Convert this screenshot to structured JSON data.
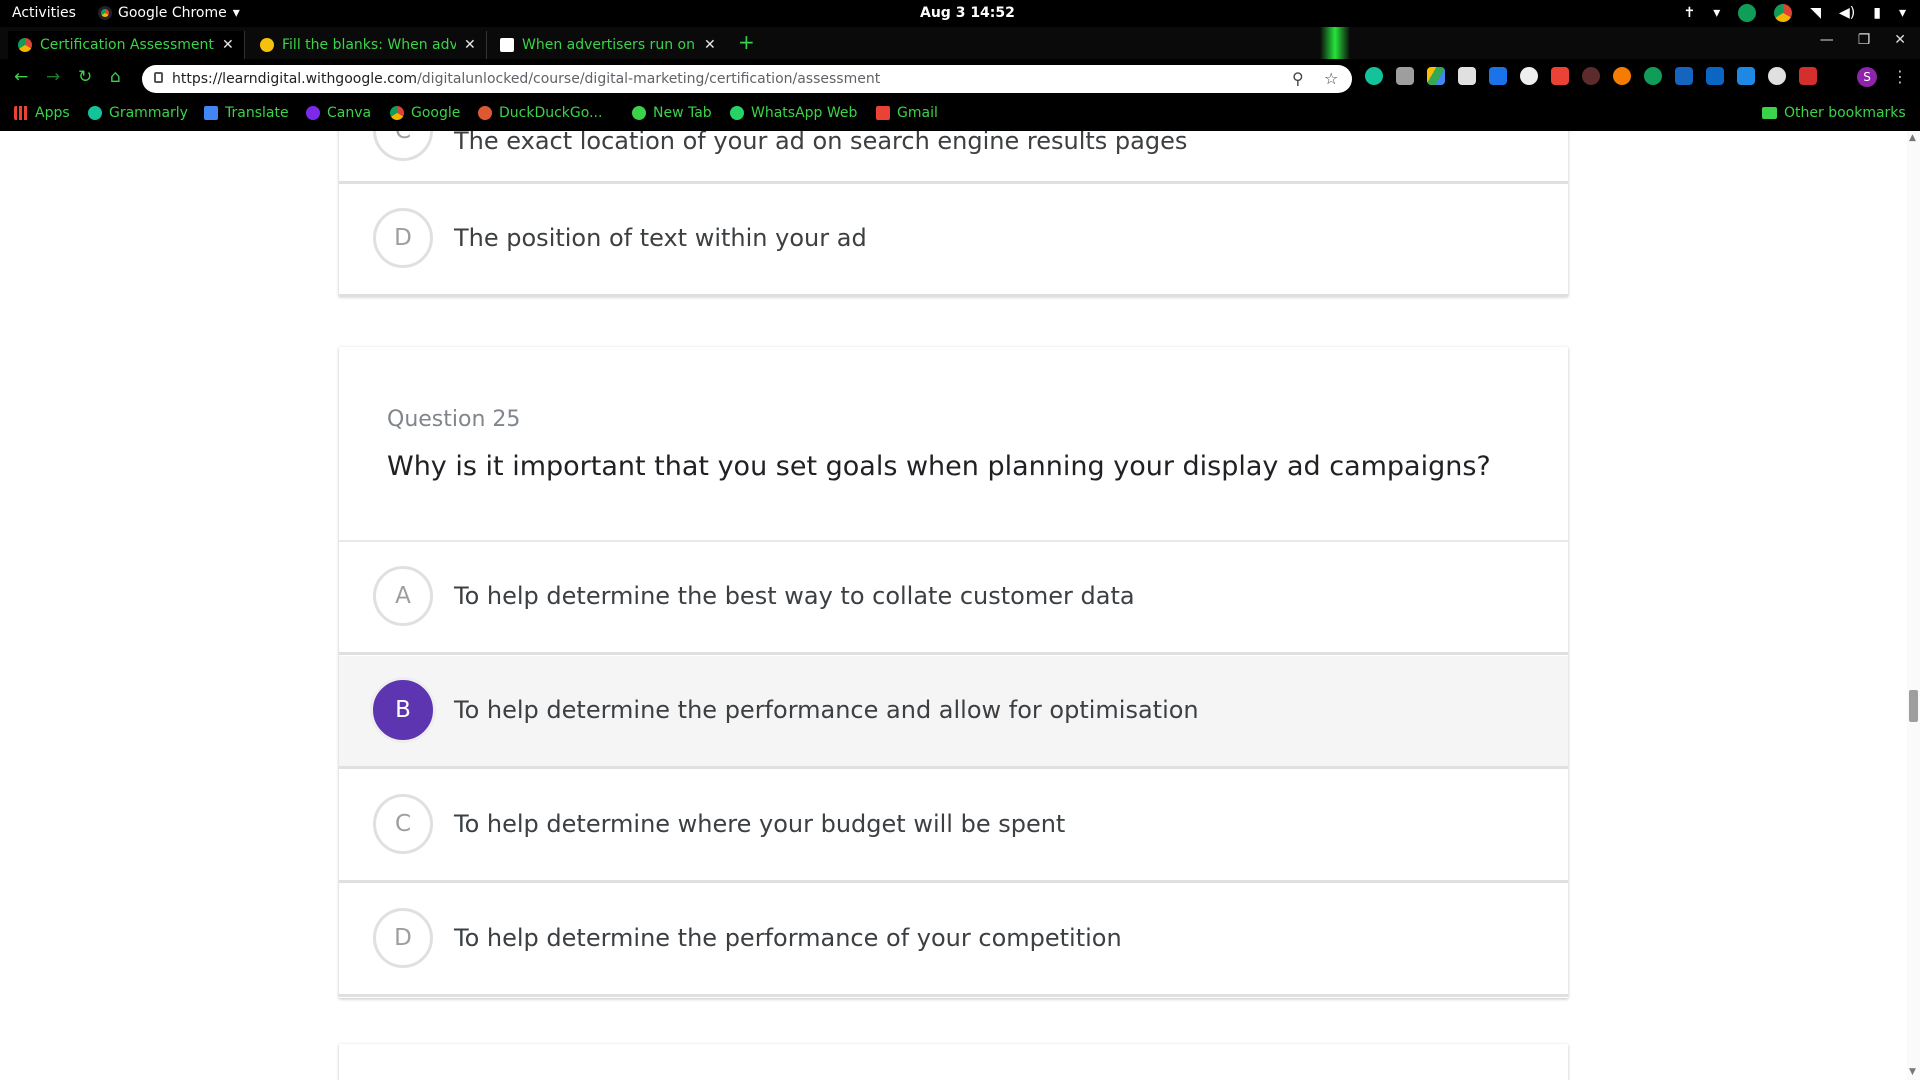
{
  "system_bar": {
    "activities": "Activities",
    "app_name": "Google Chrome",
    "clock": "Aug 3  14:52"
  },
  "tabs": [
    {
      "title": "Certification Assessment",
      "active": true
    },
    {
      "title": "Fill the blanks: When adv"
    },
    {
      "title": "When advertisers run onl"
    }
  ],
  "omnibox": {
    "host": "https://learndigital.withgoogle.com",
    "path": "/digitalunlocked/course/digital-marketing/certification/assessment"
  },
  "profile_initial": "S",
  "bookmarks": {
    "apps": "Apps",
    "items": [
      "Grammarly",
      "Translate",
      "Canva",
      "Google",
      "DuckDuckGo...",
      "New Tab",
      "WhatsApp Web",
      "Gmail"
    ],
    "other": "Other bookmarks"
  },
  "prev_question": {
    "partial_option_text": "The exact location of your ad on search engine results pages",
    "option_d": {
      "letter": "D",
      "text": "The position of text within your ad"
    }
  },
  "question": {
    "number_label": "Question 25",
    "text": "Why is it important that you set goals when planning your display ad campaigns?",
    "options": [
      {
        "letter": "A",
        "text": "To help determine the best way to collate customer data",
        "selected": false
      },
      {
        "letter": "B",
        "text": "To help determine the performance and allow for optimisation",
        "selected": true
      },
      {
        "letter": "C",
        "text": "To help determine where your budget will be spent",
        "selected": false
      },
      {
        "letter": "D",
        "text": "To help determine the performance of your competition",
        "selected": false
      }
    ]
  },
  "colors": {
    "selected_accent": "#5e35b1",
    "theme_green": "#3bd34a"
  }
}
